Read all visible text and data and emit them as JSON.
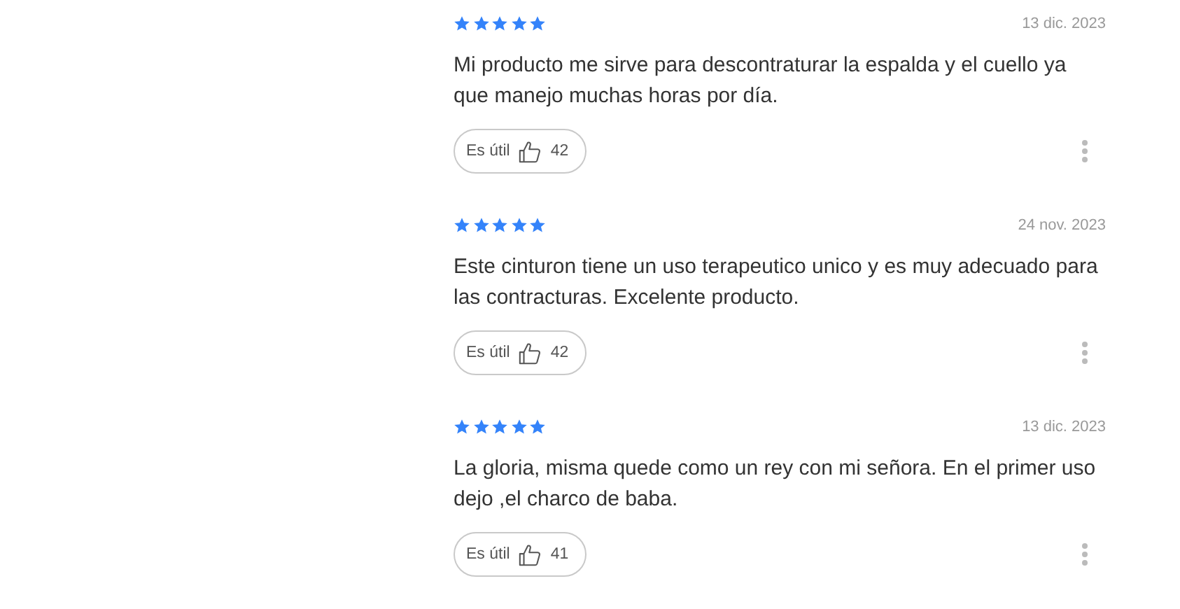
{
  "reviews": [
    {
      "stars": 5,
      "date": "13 dic. 2023",
      "text": "Mi producto me sirve para descontraturar la espalda y el cuello ya que manejo muchas horas por día.",
      "helpful_label": "Es útil",
      "helpful_count": "42"
    },
    {
      "stars": 5,
      "date": "24 nov. 2023",
      "text": "Este cinturon tiene un uso terapeutico unico y es muy adecuado para las contracturas. Excelente producto.",
      "helpful_label": "Es útil",
      "helpful_count": "42"
    },
    {
      "stars": 5,
      "date": "13 dic. 2023",
      "text": "La gloria, misma quede como un rey con mi señora. En el primer uso dejo ,el charco de baba.",
      "helpful_label": "Es útil",
      "helpful_count": "41"
    }
  ]
}
